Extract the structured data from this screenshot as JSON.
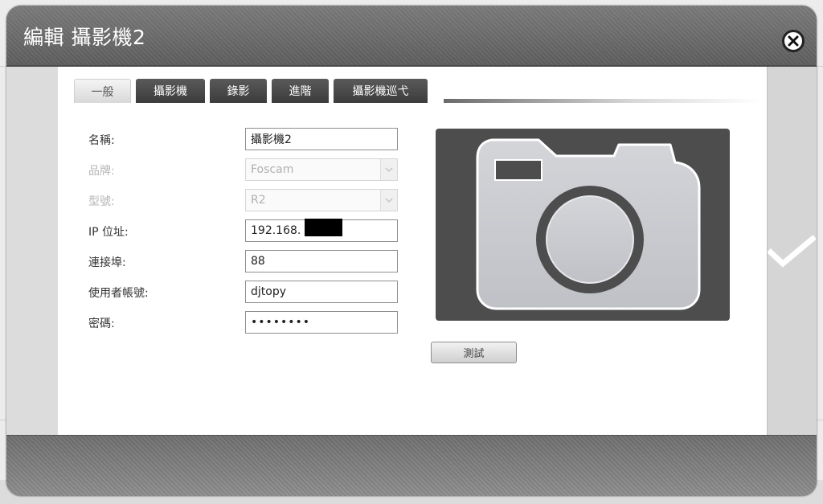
{
  "dialog": {
    "title": "編輯 攝影機2"
  },
  "tabs": [
    {
      "label": "一般",
      "active": true
    },
    {
      "label": "攝影機",
      "active": false
    },
    {
      "label": "錄影",
      "active": false
    },
    {
      "label": "進階",
      "active": false
    },
    {
      "label": "攝影機巡弋",
      "active": false
    }
  ],
  "form": {
    "name": {
      "label": "名稱:",
      "value": "攝影機2"
    },
    "brand": {
      "label": "品牌:",
      "value": "Foscam"
    },
    "model": {
      "label": "型號:",
      "value": "R2"
    },
    "ip": {
      "label": "IP 位址:",
      "value": "192.168."
    },
    "port": {
      "label": "連接埠:",
      "value": "88"
    },
    "username": {
      "label": "使用者帳號:",
      "value": "djtopy"
    },
    "password": {
      "label": "密碼:",
      "value": "••••••••"
    }
  },
  "actions": {
    "test_label": "測試"
  },
  "icons": {
    "close": "close-circle-icon",
    "confirm": "checkmark-icon",
    "camera": "camera-placeholder-icon",
    "dropdown": "chevron-down-icon"
  },
  "colors": {
    "titlebar": "#6b6b6b",
    "tab_inactive": "#4a4a4a",
    "camera_panel": "#4d4d4d",
    "camera_body": "#c9cbd0"
  }
}
